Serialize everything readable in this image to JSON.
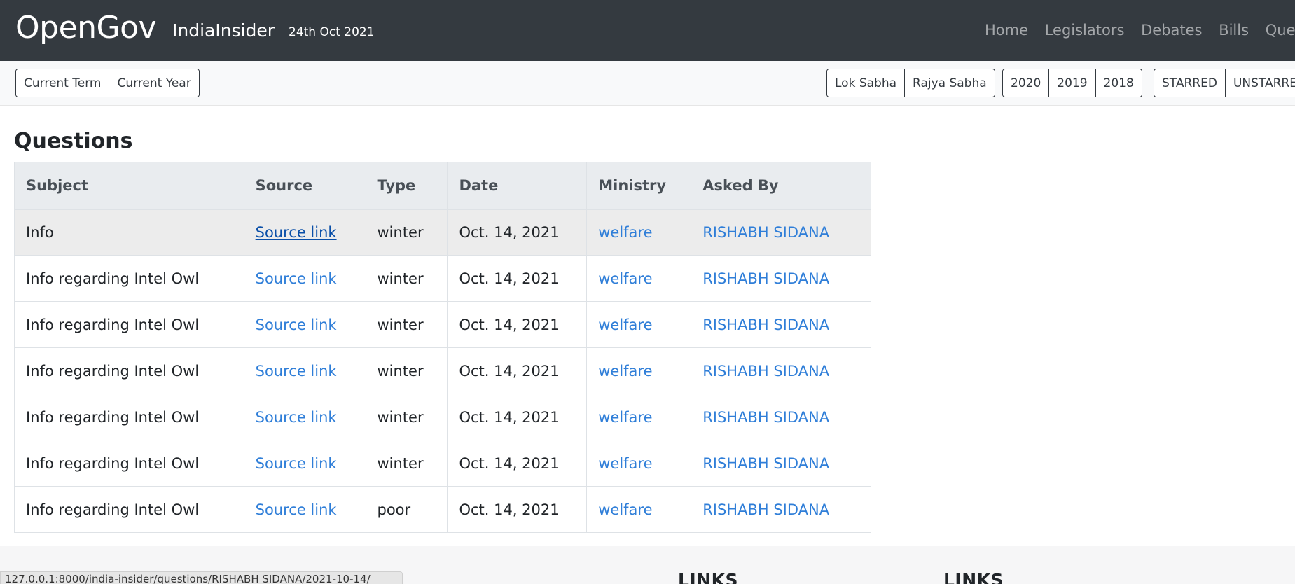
{
  "navbar": {
    "brand": "OpenGov",
    "site_name": "IndiaInsider",
    "date": "24th Oct 2021",
    "links": [
      "Home",
      "Legislators",
      "Debates",
      "Bills",
      "Questions"
    ]
  },
  "filters": {
    "term": [
      "Current Term",
      "Current Year"
    ],
    "house": [
      "Lok Sabha",
      "Rajya Sabha"
    ],
    "years": [
      "2020",
      "2019",
      "2018"
    ],
    "kind": [
      "STARRED",
      "UNSTARRED"
    ]
  },
  "main": {
    "title": "Questions",
    "columns": [
      "Subject",
      "Source",
      "Type",
      "Date",
      "Ministry",
      "Asked By"
    ],
    "rows": [
      {
        "subject": "Info",
        "source": "Source link",
        "type": "winter",
        "date": "Oct. 14, 2021",
        "ministry": "welfare",
        "asked_by": "RISHABH SIDANA"
      },
      {
        "subject": "Info regarding Intel Owl",
        "source": "Source link",
        "type": "winter",
        "date": "Oct. 14, 2021",
        "ministry": "welfare",
        "asked_by": "RISHABH SIDANA"
      },
      {
        "subject": "Info regarding Intel Owl",
        "source": "Source link",
        "type": "winter",
        "date": "Oct. 14, 2021",
        "ministry": "welfare",
        "asked_by": "RISHABH SIDANA"
      },
      {
        "subject": "Info regarding Intel Owl",
        "source": "Source link",
        "type": "winter",
        "date": "Oct. 14, 2021",
        "ministry": "welfare",
        "asked_by": "RISHABH SIDANA"
      },
      {
        "subject": "Info regarding Intel Owl",
        "source": "Source link",
        "type": "winter",
        "date": "Oct. 14, 2021",
        "ministry": "welfare",
        "asked_by": "RISHABH SIDANA"
      },
      {
        "subject": "Info regarding Intel Owl",
        "source": "Source link",
        "type": "winter",
        "date": "Oct. 14, 2021",
        "ministry": "welfare",
        "asked_by": "RISHABH SIDANA"
      },
      {
        "subject": "Info regarding Intel Owl",
        "source": "Source link",
        "type": "poor",
        "date": "Oct. 14, 2021",
        "ministry": "welfare",
        "asked_by": "RISHABH SIDANA"
      }
    ]
  },
  "footer": {
    "headings": [
      "LINKS",
      "LINKS"
    ],
    "status_url": "127.0.0.1:8000/india-insider/questions/RISHABH SIDANA/2021-10-14/"
  },
  "colors": {
    "navbar_bg": "#343a40",
    "link": "#2f7ed8",
    "header_bg": "#e9ecef"
  }
}
